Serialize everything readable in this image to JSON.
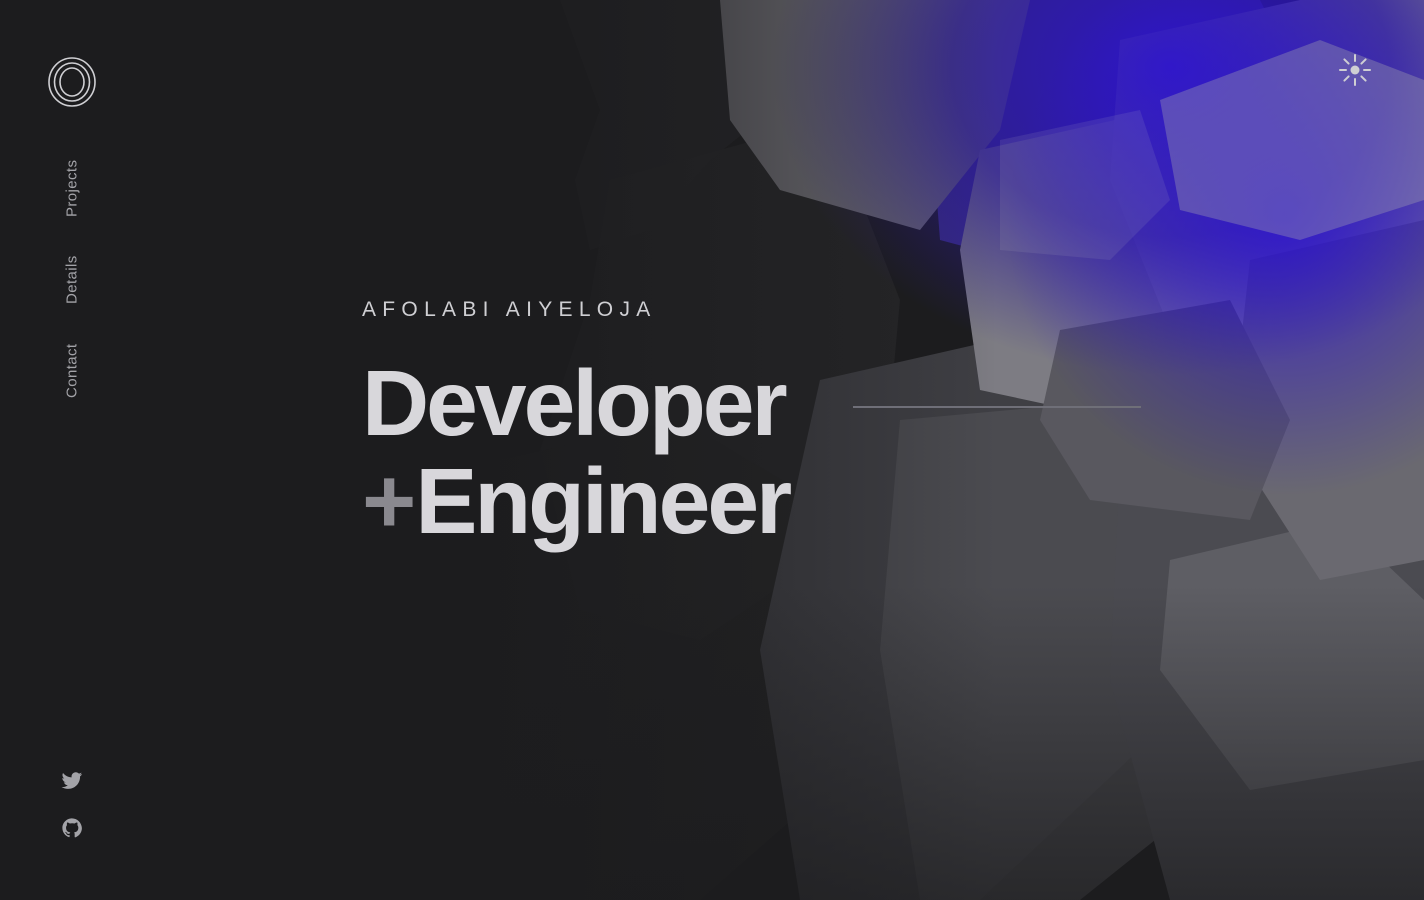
{
  "nav": {
    "items": [
      {
        "label": "Projects"
      },
      {
        "label": "Details"
      },
      {
        "label": "Contact"
      }
    ]
  },
  "hero": {
    "name": "AFOLABI AIYELOJA",
    "headline_line_1": "Developer",
    "plus": "+",
    "headline_line_2": "Engineer"
  },
  "icons": {
    "logo": "logo-icon",
    "theme_toggle": "sun-icon",
    "social": [
      "twitter-icon",
      "github-icon"
    ]
  },
  "colors": {
    "background": "#1c1c1e",
    "text": "#d8d7db",
    "muted": "#a3a3a8",
    "accent": "#2d17c7"
  }
}
